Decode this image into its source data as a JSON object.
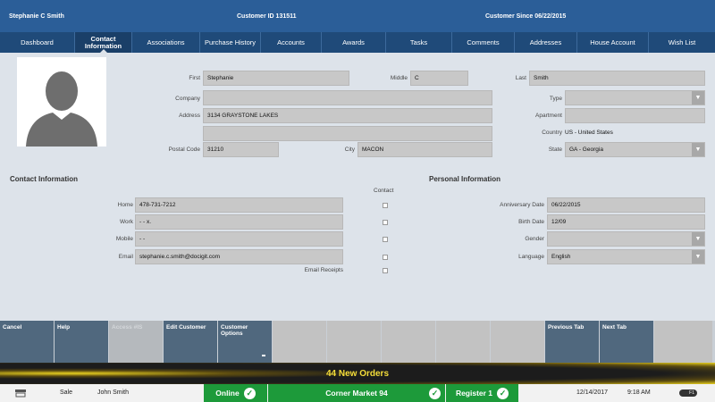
{
  "header": {
    "customer_name": "Stephanie C Smith",
    "customer_id": "Customer ID 131511",
    "customer_since": "Customer Since 06/22/2015"
  },
  "tabs": [
    {
      "label": "Dashboard"
    },
    {
      "label": "Contact Information",
      "active": true
    },
    {
      "label": "Associations"
    },
    {
      "label": "Purchase History"
    },
    {
      "label": "Accounts"
    },
    {
      "label": "Awards"
    },
    {
      "label": "Tasks"
    },
    {
      "label": "Comments"
    },
    {
      "label": "Addresses"
    },
    {
      "label": "House Account"
    },
    {
      "label": "Wish List"
    }
  ],
  "form": {
    "first_label": "First",
    "first_value": "Stephanie",
    "middle_label": "Middle",
    "middle_value": "C",
    "last_label": "Last",
    "last_value": "Smith",
    "company_label": "Company",
    "company_value": "",
    "type_label": "Type",
    "type_value": "",
    "address_label": "Address",
    "address_value": "3134 GRAYSTONE LAKES",
    "address2_value": "",
    "apartment_label": "Apartment",
    "apartment_value": "",
    "country_label": "Country",
    "country_value": "US - United States",
    "postal_label": "Postal Code",
    "postal_value": "31210",
    "city_label": "City",
    "city_value": "MACON",
    "state_label": "State",
    "state_value": "GA - Georgia"
  },
  "contact": {
    "title": "Contact Information",
    "contact_col": "Contact",
    "home_label": "Home",
    "home_value": "478-731-7212",
    "work_label": "Work",
    "work_value": "-   -       x.",
    "mobile_label": "Mobile",
    "mobile_value": "-   -",
    "email_label": "Email",
    "email_value": "stephanie.c.smith@docigit.com",
    "receipts_label": "Email Receipts"
  },
  "personal": {
    "title": "Personal Information",
    "anniversary_label": "Anniversary Date",
    "anniversary_value": "06/22/2015",
    "birth_label": "Birth Date",
    "birth_value": "12/09",
    "gender_label": "Gender",
    "gender_value": "",
    "language_label": "Language",
    "language_value": "English"
  },
  "buttons": {
    "cancel": "Cancel",
    "help": "Help",
    "disabled_btn": "Access #IS",
    "edit": "Edit Customer",
    "options": "Customer Options",
    "prev": "Previous Tab",
    "next": "Next Tab"
  },
  "orders_banner": "44 New Orders",
  "status": {
    "mode": "Sale",
    "user": "John Smith",
    "online": "Online",
    "store": "Corner Market 94",
    "register": "Register 1",
    "date": "12/14/2017",
    "time": "9:18 AM",
    "toggle": "F1"
  },
  "colors": {
    "header": "#2b5e98",
    "tabs": "#1f4a79",
    "button_blue": "#50687e",
    "status_green": "#1d9a3a",
    "banner_text": "#f4dd3a"
  }
}
